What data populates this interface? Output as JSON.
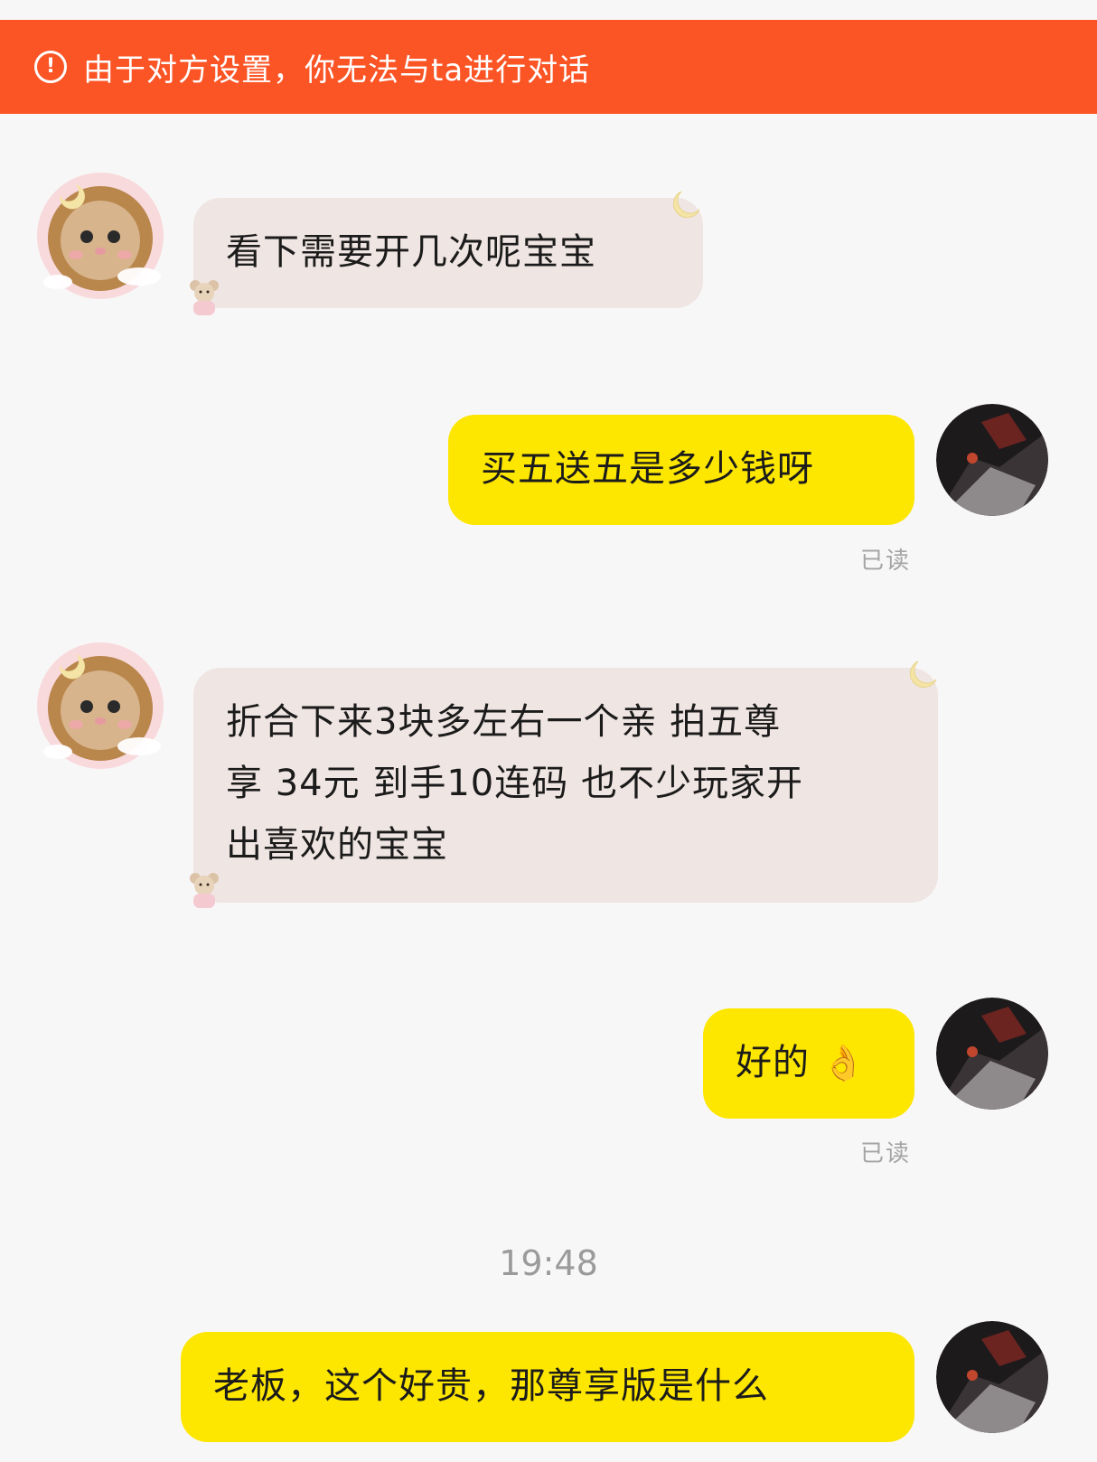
{
  "banner": {
    "icon": "alert-circle-icon",
    "text": "由于对方设置，你无法与ta进行对话"
  },
  "messages": [
    {
      "side": "incoming",
      "text": "看下需要开几次呢宝宝",
      "avatar": "kitten-lion-avatar"
    },
    {
      "side": "outgoing",
      "text": "买五送五是多少钱呀",
      "status": "已读",
      "avatar": "dark-figure-avatar"
    },
    {
      "side": "incoming",
      "lines": [
        "折合下来3块多左右一个亲 拍五尊",
        "享 34元 到手10连码 也不少玩家开",
        "出喜欢的宝宝"
      ],
      "avatar": "kitten-lion-avatar"
    },
    {
      "side": "outgoing",
      "text": "好的",
      "emoji": "👌",
      "status": "已读",
      "avatar": "dark-figure-avatar"
    },
    {
      "side": "outgoing",
      "text": "老板，这个好贵，那尊享版是什么",
      "avatar": "dark-figure-avatar"
    }
  ],
  "timestamp": "19:48",
  "colors": {
    "banner": "#fb5425",
    "incoming_bubble": "#efe5e2",
    "outgoing_bubble": "#fde600"
  }
}
